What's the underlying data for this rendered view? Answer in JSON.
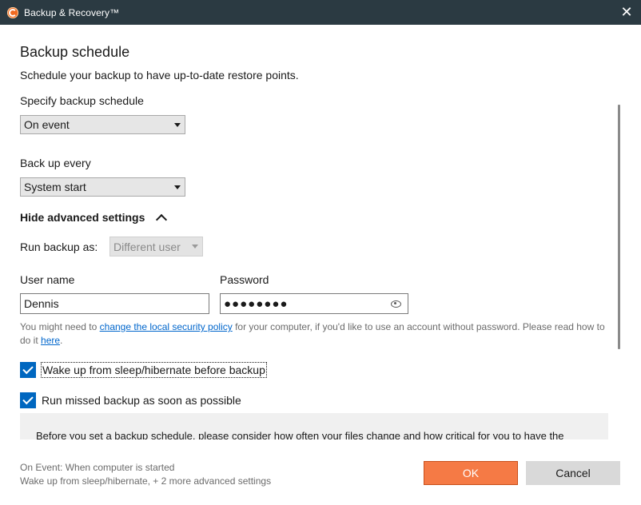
{
  "window": {
    "title": "Backup & Recovery™",
    "app_icon": "app-logo-icon",
    "close_icon": "close-icon",
    "close_symbol": "✕"
  },
  "page": {
    "heading": "Backup schedule",
    "subheading": "Schedule your backup to have up-to-date restore points."
  },
  "schedule": {
    "label": "Specify backup schedule",
    "value": "On event"
  },
  "every": {
    "label": "Back up every",
    "value": "System start"
  },
  "advanced": {
    "toggle_label": "Hide advanced settings",
    "run_as_label": "Run backup as:",
    "run_as_value": "Different user",
    "username_label": "User name",
    "username_value": "Dennis",
    "password_label": "Password",
    "password_value": "●●●●●●●●",
    "hint_before": "You might need to ",
    "hint_link1": "change the local security policy",
    "hint_middle": " for your computer, if you'd like to use an account without password. Please read how to do it ",
    "hint_link2": "here",
    "hint_after": ".",
    "wake_label": "Wake up from sleep/hibernate before backup",
    "wake_checked": true,
    "missed_label": "Run missed backup as soon as possible",
    "missed_checked": true
  },
  "info": {
    "text": "Before you set a backup schedule, please consider how often your files change and how critical for you to have the"
  },
  "footer": {
    "summary_line1": "On Event: When computer is started",
    "summary_line2": "Wake up from sleep/hibernate, + 2 more advanced settings",
    "ok_label": "OK",
    "cancel_label": "Cancel"
  },
  "colors": {
    "titlebar": "#2b3a42",
    "accent_ok": "#f57a45",
    "checkbox": "#0067c0",
    "link": "#0066cc"
  }
}
